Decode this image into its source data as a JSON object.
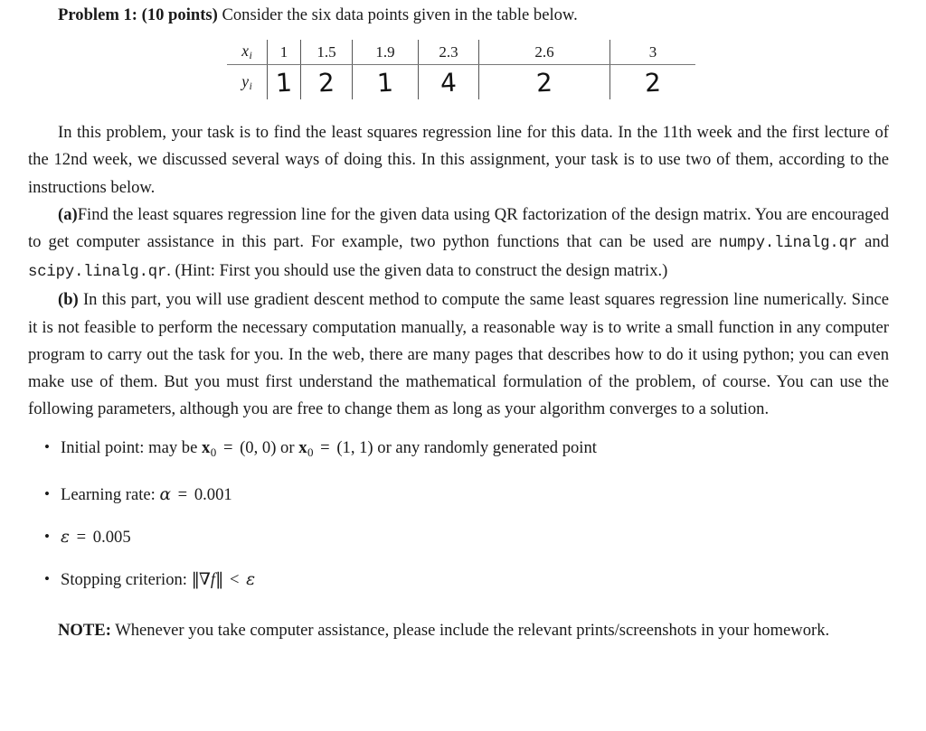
{
  "document": {
    "problem": {
      "heading_bold_1": "Problem 1:",
      "heading_bold_2": "(10 points)",
      "heading_rest": "Consider the six data points given in the table below."
    },
    "table": {
      "row_labels": {
        "x": "x",
        "y": "y",
        "subscript": "i"
      },
      "x_values": [
        "1",
        "1.5",
        "1.9",
        "2.3",
        "2.6",
        "3"
      ],
      "y_values": [
        "1",
        "2",
        "1",
        "4",
        "2",
        "2"
      ]
    },
    "paragraphs": {
      "intro": "In this problem, your task is to find the least squares regression line for this data. In the 11th week and the first lecture of the 12nd week, we discussed several ways of doing this. In this assignment, your task is to use two of them, according to the instructions below.",
      "part_a_label": "(a)",
      "part_a_text_1": "Find the least squares regression line for the given data using QR factorization of the design matrix. You are encouraged to get computer assistance in this part. For example, two python functions that can be used are ",
      "part_a_code_1": "numpy.linalg.qr",
      "part_a_text_2": " and ",
      "part_a_code_2": "scipy.linalg.qr",
      "part_a_text_3": ". (Hint: First you should use the given data to construct the design matrix.)",
      "part_b_label": "(b)",
      "part_b_text": "In this part, you will use gradient descent method to compute the same least squares regression line numerically. Since it is not feasible to perform the necessary computation manually, a reasonable way is to write a small function in any computer program to carry out the task for you. In the web, there are many pages that describes how to do it using python; you can even make use of them. But you must first understand the mathematical formulation of the problem, of course. You can use the following parameters, although you are free to change them as long as your algorithm converges to a solution."
    },
    "bullets": {
      "marker": "•",
      "initial_point": {
        "label": "Initial point:",
        "text_1": "may be",
        "var": "x",
        "var_sub": "0",
        "eq": "=",
        "val_1": "(0, 0)",
        "or": "or",
        "val_2": "(1, 1)",
        "text_2": "or any randomly generated point"
      },
      "learning_rate": {
        "label": "Learning rate:",
        "symbol": "α",
        "eq": "=",
        "value": "0.001"
      },
      "epsilon": {
        "symbol": "ε",
        "eq": "=",
        "value": "0.005"
      },
      "stopping": {
        "label": "Stopping criterion:",
        "norm_open": "‖",
        "grad": "∇",
        "fn": "f",
        "norm_close": "‖",
        "rel": "<",
        "symbol": "ε"
      }
    },
    "note": {
      "label": "NOTE:",
      "text": "Whenever you take computer assistance, please include the relevant prints/screenshots in your homework."
    }
  }
}
